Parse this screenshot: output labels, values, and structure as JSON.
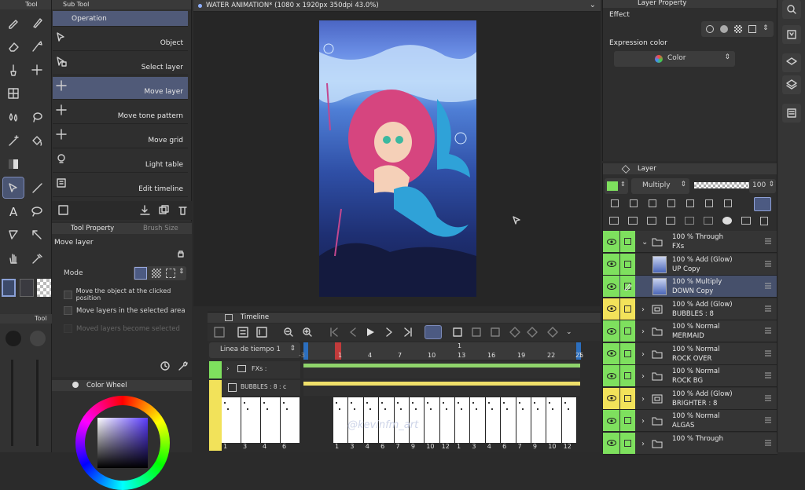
{
  "toolbar": {
    "tool_tab": "Tool",
    "sub_tool_tab": "Sub Tool",
    "tool_small_tab": "Tool"
  },
  "subtool": {
    "items": [
      {
        "label": "Operation"
      },
      {
        "label": "Object"
      },
      {
        "label": "Select layer"
      },
      {
        "label": "Move layer"
      },
      {
        "label": "Move tone pattern"
      },
      {
        "label": "Move grid"
      },
      {
        "label": "Light table"
      },
      {
        "label": "Edit timeline"
      }
    ]
  },
  "toolprop": {
    "tab1": "Tool Property",
    "tab2": "Brush Size",
    "title": "Move layer",
    "mode_label": "Mode",
    "opt1": "Move the object at the clicked position",
    "opt2": "Move layers in the selected area",
    "opt3": "Moved layers become selected"
  },
  "colorwheel": {
    "title": "Color Wheel"
  },
  "document": {
    "title": "WATER ANIMATION* (1080 x 1920px 350dpi 43.0%)"
  },
  "timeline": {
    "title": "Timeline",
    "timeline_name": "Linea de tiempo 1",
    "ruler_top": [
      "1",
      "4",
      "7",
      "10",
      "13",
      "16",
      "19",
      "22",
      "1"
    ],
    "ruler_marks": [
      "-3",
      "25",
      "1"
    ],
    "tracks": [
      {
        "name": "FXs :"
      },
      {
        "name": "BUBBLES : 8 : c"
      }
    ],
    "left_frames": [
      "1",
      "3",
      "4",
      "6"
    ],
    "right_frames": [
      "1",
      "3",
      "4",
      "6",
      "7",
      "9",
      "10",
      "12",
      "1",
      "3",
      "4",
      "6",
      "7",
      "9",
      "10",
      "12"
    ],
    "watermark": "@kevinfm_art"
  },
  "layerprop": {
    "title": "Layer Property",
    "effect_label": "Effect",
    "expression_label": "Expression color",
    "expression_value": "Color"
  },
  "layer": {
    "title": "Layer",
    "blend_mode": "Multiply",
    "opacity": "100",
    "rows": [
      {
        "line1": "100 %  Through",
        "line2": "FXs",
        "type": "folder",
        "eye": "green",
        "expanded": true
      },
      {
        "line1": "100 %  Add (Glow)",
        "line2": "UP Copy",
        "type": "raster",
        "eye": "green"
      },
      {
        "line1": "100 %  Multiply",
        "line2": "DOWN Copy",
        "type": "raster",
        "eye": "green",
        "selected": true
      },
      {
        "line1": "100 %  Add (Glow)",
        "line2": "BUBBLES : 8",
        "type": "anim",
        "eye": "yellow"
      },
      {
        "line1": "100 %  Normal",
        "line2": "MERMAID",
        "type": "folder",
        "eye": "green"
      },
      {
        "line1": "100 %  Normal",
        "line2": "ROCK OVER",
        "type": "folder",
        "eye": "green"
      },
      {
        "line1": "100 %  Normal",
        "line2": "ROCK BG",
        "type": "folder",
        "eye": "green"
      },
      {
        "line1": "100 %  Add (Glow)",
        "line2": "BRIGHTER  : 8",
        "type": "anim",
        "eye": "yellow"
      },
      {
        "line1": "100 %  Normal",
        "line2": "ALGAS",
        "type": "folder",
        "eye": "green"
      },
      {
        "line1": "100 %  Through",
        "line2": "",
        "type": "folder",
        "eye": "green"
      }
    ]
  },
  "colors": {
    "accent": "#505a78",
    "eye_green": "#7ee05e",
    "eye_yellow": "#f2e25a",
    "track_green": "#8fd46b",
    "track_yellow": "#f0e06a"
  }
}
